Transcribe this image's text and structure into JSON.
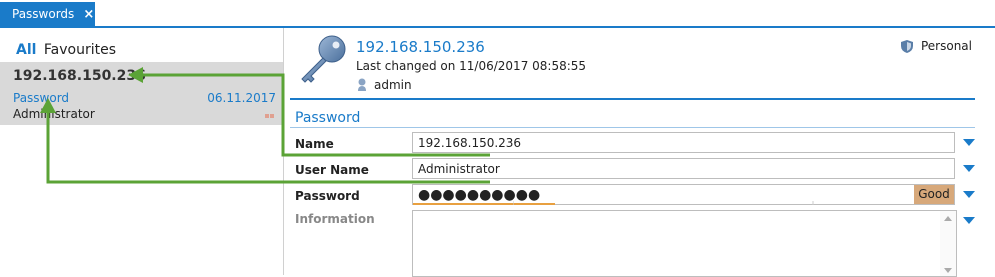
{
  "tab": {
    "label": "Passwords",
    "close": "×"
  },
  "left": {
    "filter_all": "All",
    "filter_favourites": "Favourites",
    "entry": {
      "title": "192.168.150.236",
      "type": "Password",
      "date": "06.11.2017",
      "user": "Administrator"
    }
  },
  "header": {
    "title": "192.168.150.236",
    "last_changed": "Last changed on 11/06/2017 08:58:55",
    "user": "admin",
    "personal": "Personal"
  },
  "section": {
    "title": "Password"
  },
  "fields": {
    "name_label": "Name",
    "name_value": "192.168.150.236",
    "username_label": "User Name",
    "username_value": "Administrator",
    "password_label": "Password",
    "password_value": "●●●●●●●●●●",
    "password_strength": "Good",
    "information_label": "Information"
  },
  "colors": {
    "accent": "#1a7bc9",
    "arrow": "#5ba336",
    "strength": "#d7a87a"
  },
  "icons": [
    "close-icon",
    "key-icon",
    "user-icon",
    "shield-icon",
    "chevron-down-icon"
  ]
}
